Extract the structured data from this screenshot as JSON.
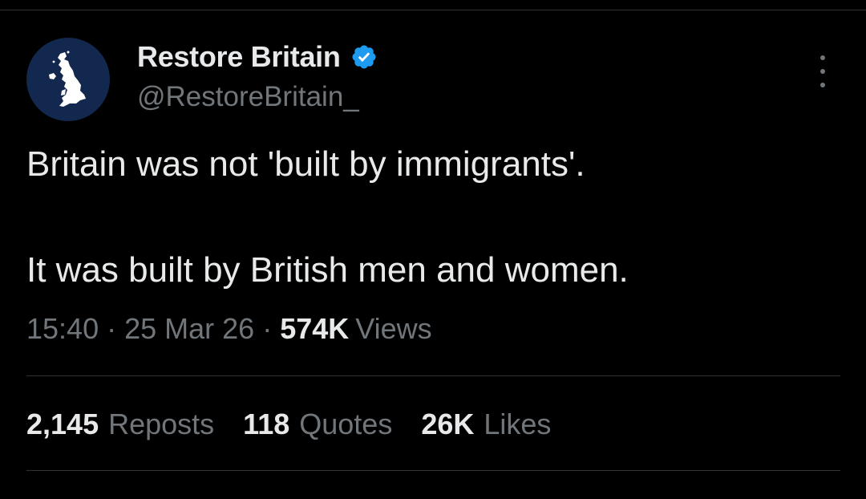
{
  "author": {
    "display_name": "Restore Britain",
    "handle": "@RestoreBritain_",
    "verified": true,
    "avatar_icon": "uk-map-icon",
    "avatar_bg": "#13284f"
  },
  "menu": {
    "icon": "more-vertical-icon"
  },
  "tweet": {
    "line1": "Britain was not 'built by immigrants'.",
    "line2": "It was built by British men and women."
  },
  "meta": {
    "time": "15:40",
    "separator": "·",
    "date": "25 Mar 26",
    "views_count": "574K",
    "views_label": "Views"
  },
  "stats": {
    "reposts_count": "2,145",
    "reposts_label": "Reposts",
    "quotes_count": "118",
    "quotes_label": "Quotes",
    "likes_count": "26K",
    "likes_label": "Likes"
  },
  "colors": {
    "background": "#000000",
    "primary_text": "#e7e9ea",
    "secondary_text": "#71767b",
    "verified_badge": "#1d9bf0",
    "divider": "#2f3336"
  }
}
